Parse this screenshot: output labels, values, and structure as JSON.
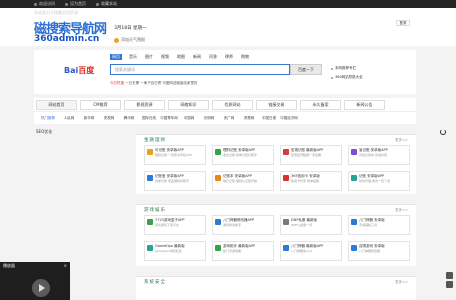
{
  "topbar": {
    "welcome": "欢迎访问",
    "home": "设为首页",
    "fav": "收藏本站"
  },
  "subbar": {
    "text": "本站致力于搜集实用资源"
  },
  "header": {
    "logo_line1": "磁搜索导航网",
    "logo_line2": "360admin.cn",
    "date": "3月18日 星期一",
    "weather": "添加天气预报",
    "login": "登录"
  },
  "search": {
    "tabs": [
      "网页",
      "音乐",
      "图片",
      "视频",
      "地图",
      "新闻",
      "问答",
      "律师",
      "购物"
    ],
    "brand_a": "Bai",
    "brand_b": "百度",
    "placeholder": "搜索关键词",
    "button": "百度一下",
    "hot_label": "今日热搜",
    "hot": "一日夫妻 一辈子百日恩 可爱网站链接给家里的",
    "side": [
      "本网推荐专栏",
      "360网站导航大全"
    ]
  },
  "nav": {
    "items": [
      "网站首页",
      "CM推荐",
      "影视资源",
      "网络知识",
      "优质网站",
      "链接交易",
      "永久备案",
      "新闻公告"
    ],
    "sub": [
      "热门推荐",
      "人民网",
      "新华网",
      "央视网",
      "腾讯网",
      "国际在线",
      "中国青年网",
      "中国网",
      "光明网",
      "央广网",
      "求是网",
      "中国日报",
      "中国经济网"
    ]
  },
  "seo": "SEO优化",
  "sections": [
    {
      "title": "金融理财",
      "more": "更多>>",
      "cards": [
        {
          "t": "可记账 安卓版APP",
          "d": "理财记账,一款安卓手机APP",
          "c": "#e8a21a"
        },
        {
          "t": "理财记账 安卓版APP",
          "d": "收支记账,简单记账好帮手",
          "c": "#3aa04a"
        },
        {
          "t": "宏观记账 最新版APP",
          "d": "宏观经济数据一手掌握",
          "c": "#d33c3c"
        },
        {
          "t": "省记账 安卓版APP",
          "d": "省钱记账本,简洁好用",
          "c": "#7a4fd0"
        },
        {
          "t": "记账宝 安卓版APP",
          "d": "简单记账 家庭理财好帮手",
          "c": "#2f7ad6"
        },
        {
          "t": "记账本 安卓版APP",
          "d": "每日记账,理财从记账开始",
          "c": "#e8891a"
        },
        {
          "t": "365信用卡 安卓版",
          "d": "信用卡管家 账单提醒",
          "c": "#d8342e"
        },
        {
          "t": "记账 安卓版APP",
          "d": "财务管理,收支一目了然",
          "c": "#27a39a"
        }
      ]
    },
    {
      "title": "游戏娱乐",
      "more": "更多>>",
      "cards": [
        {
          "t": "7723游戏盒子APP",
          "d": "手机游戏下载平台",
          "c": "#3aa04a"
        },
        {
          "t": "八门神器修改器APP",
          "d": "游戏修改助手",
          "c": "#2f7ad6"
        },
        {
          "t": "DNF私服 最新版",
          "d": "DNF公益服一览",
          "c": "#7a7a7a"
        },
        {
          "t": "八门神器 安卓版",
          "d": "手游辅助工具",
          "c": "#2f7ad6"
        },
        {
          "t": "GameKipo 最新版",
          "d": "gamekipo游戏社区",
          "c": "#27a39a"
        },
        {
          "t": "游戏助手 最新版APP",
          "d": "热门手游攻略",
          "c": "#3aa04a"
        },
        {
          "t": "八门神器 最新版APP",
          "d": "八门神器免root",
          "c": "#2f7ad6"
        },
        {
          "t": "百啸游戏 安卓版",
          "d": "八门神器修改器",
          "c": "#2f7ad6"
        }
      ]
    },
    {
      "title": "系统安全",
      "more": "更多>>",
      "cards": []
    }
  ],
  "player": {
    "label": "播放器",
    "close": "×"
  }
}
